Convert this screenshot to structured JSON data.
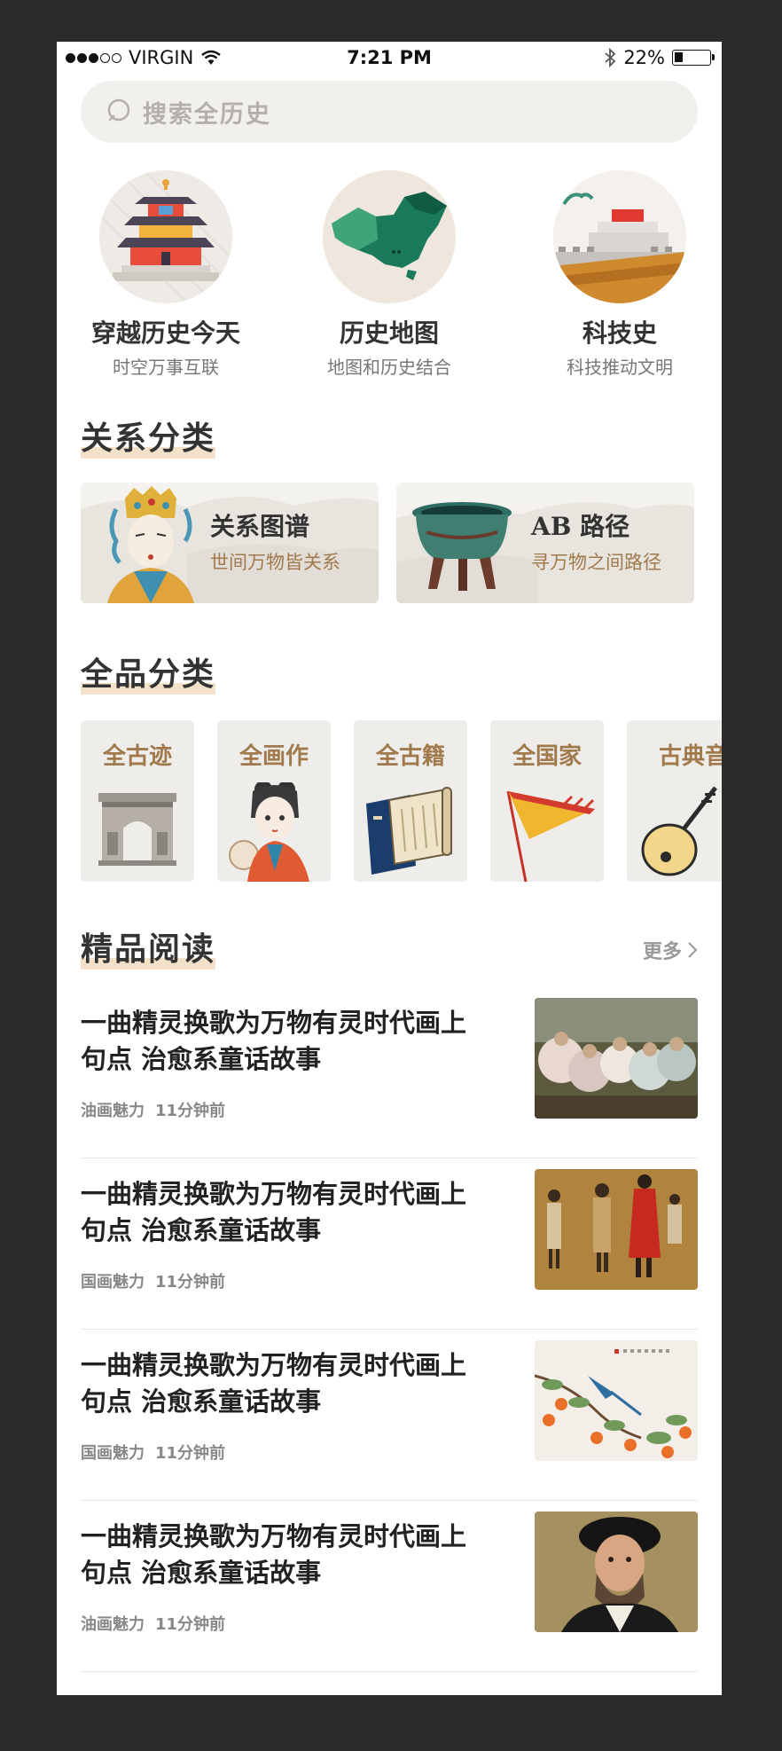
{
  "status": {
    "carrier": "VIRGIN",
    "time": "7:21 PM",
    "battery": "22%"
  },
  "search": {
    "placeholder": "搜索全历史"
  },
  "features": [
    {
      "title": "穿越历史今天",
      "subtitle": "时空万事互联",
      "icon": "temple-icon"
    },
    {
      "title": "历史地图",
      "subtitle": "地图和历史结合",
      "icon": "map-icon"
    },
    {
      "title": "科技史",
      "subtitle": "科技推动文明",
      "icon": "great-wall-icon"
    }
  ],
  "relations": {
    "header": "关系分类",
    "cards": [
      {
        "name": "关系图谱",
        "desc": "世间万物皆关系",
        "icon": "empress-portrait-icon"
      },
      {
        "name": "AB 路径",
        "desc": "寻万物之间路径",
        "icon": "bronze-ding-icon"
      }
    ]
  },
  "categories": {
    "header": "全品分类",
    "items": [
      {
        "label": "全古迹",
        "icon": "arch-monument-icon"
      },
      {
        "label": "全画作",
        "icon": "ancient-lady-icon"
      },
      {
        "label": "全古籍",
        "icon": "scroll-book-icon"
      },
      {
        "label": "全国家",
        "icon": "flag-icon"
      },
      {
        "label": "古典音",
        "icon": "pipa-icon"
      }
    ]
  },
  "reading": {
    "header": "精品阅读",
    "more": "更多",
    "articles": [
      {
        "title": "一曲精灵换歌为万物有灵时代画上句点 治愈系童话故事",
        "source": "油画魅力",
        "time": "11分钟前",
        "thumb": "oil-painting-group-thumb"
      },
      {
        "title": "一曲精灵换歌为万物有灵时代画上句点 治愈系童话故事",
        "source": "国画魅力",
        "time": "11分钟前",
        "thumb": "chinese-figures-thumb"
      },
      {
        "title": "一曲精灵换歌为万物有灵时代画上句点 治愈系童话故事",
        "source": "国画魅力",
        "time": "11分钟前",
        "thumb": "persimmon-bird-thumb"
      },
      {
        "title": "一曲精灵换歌为万物有灵时代画上句点 治愈系童话故事",
        "source": "油画魅力",
        "time": "11分钟前",
        "thumb": "portrait-man-thumb"
      }
    ]
  },
  "colors": {
    "accent": "#a07a4c",
    "highlight": "#f3e2c9",
    "search_bg": "#f1f0ec"
  }
}
